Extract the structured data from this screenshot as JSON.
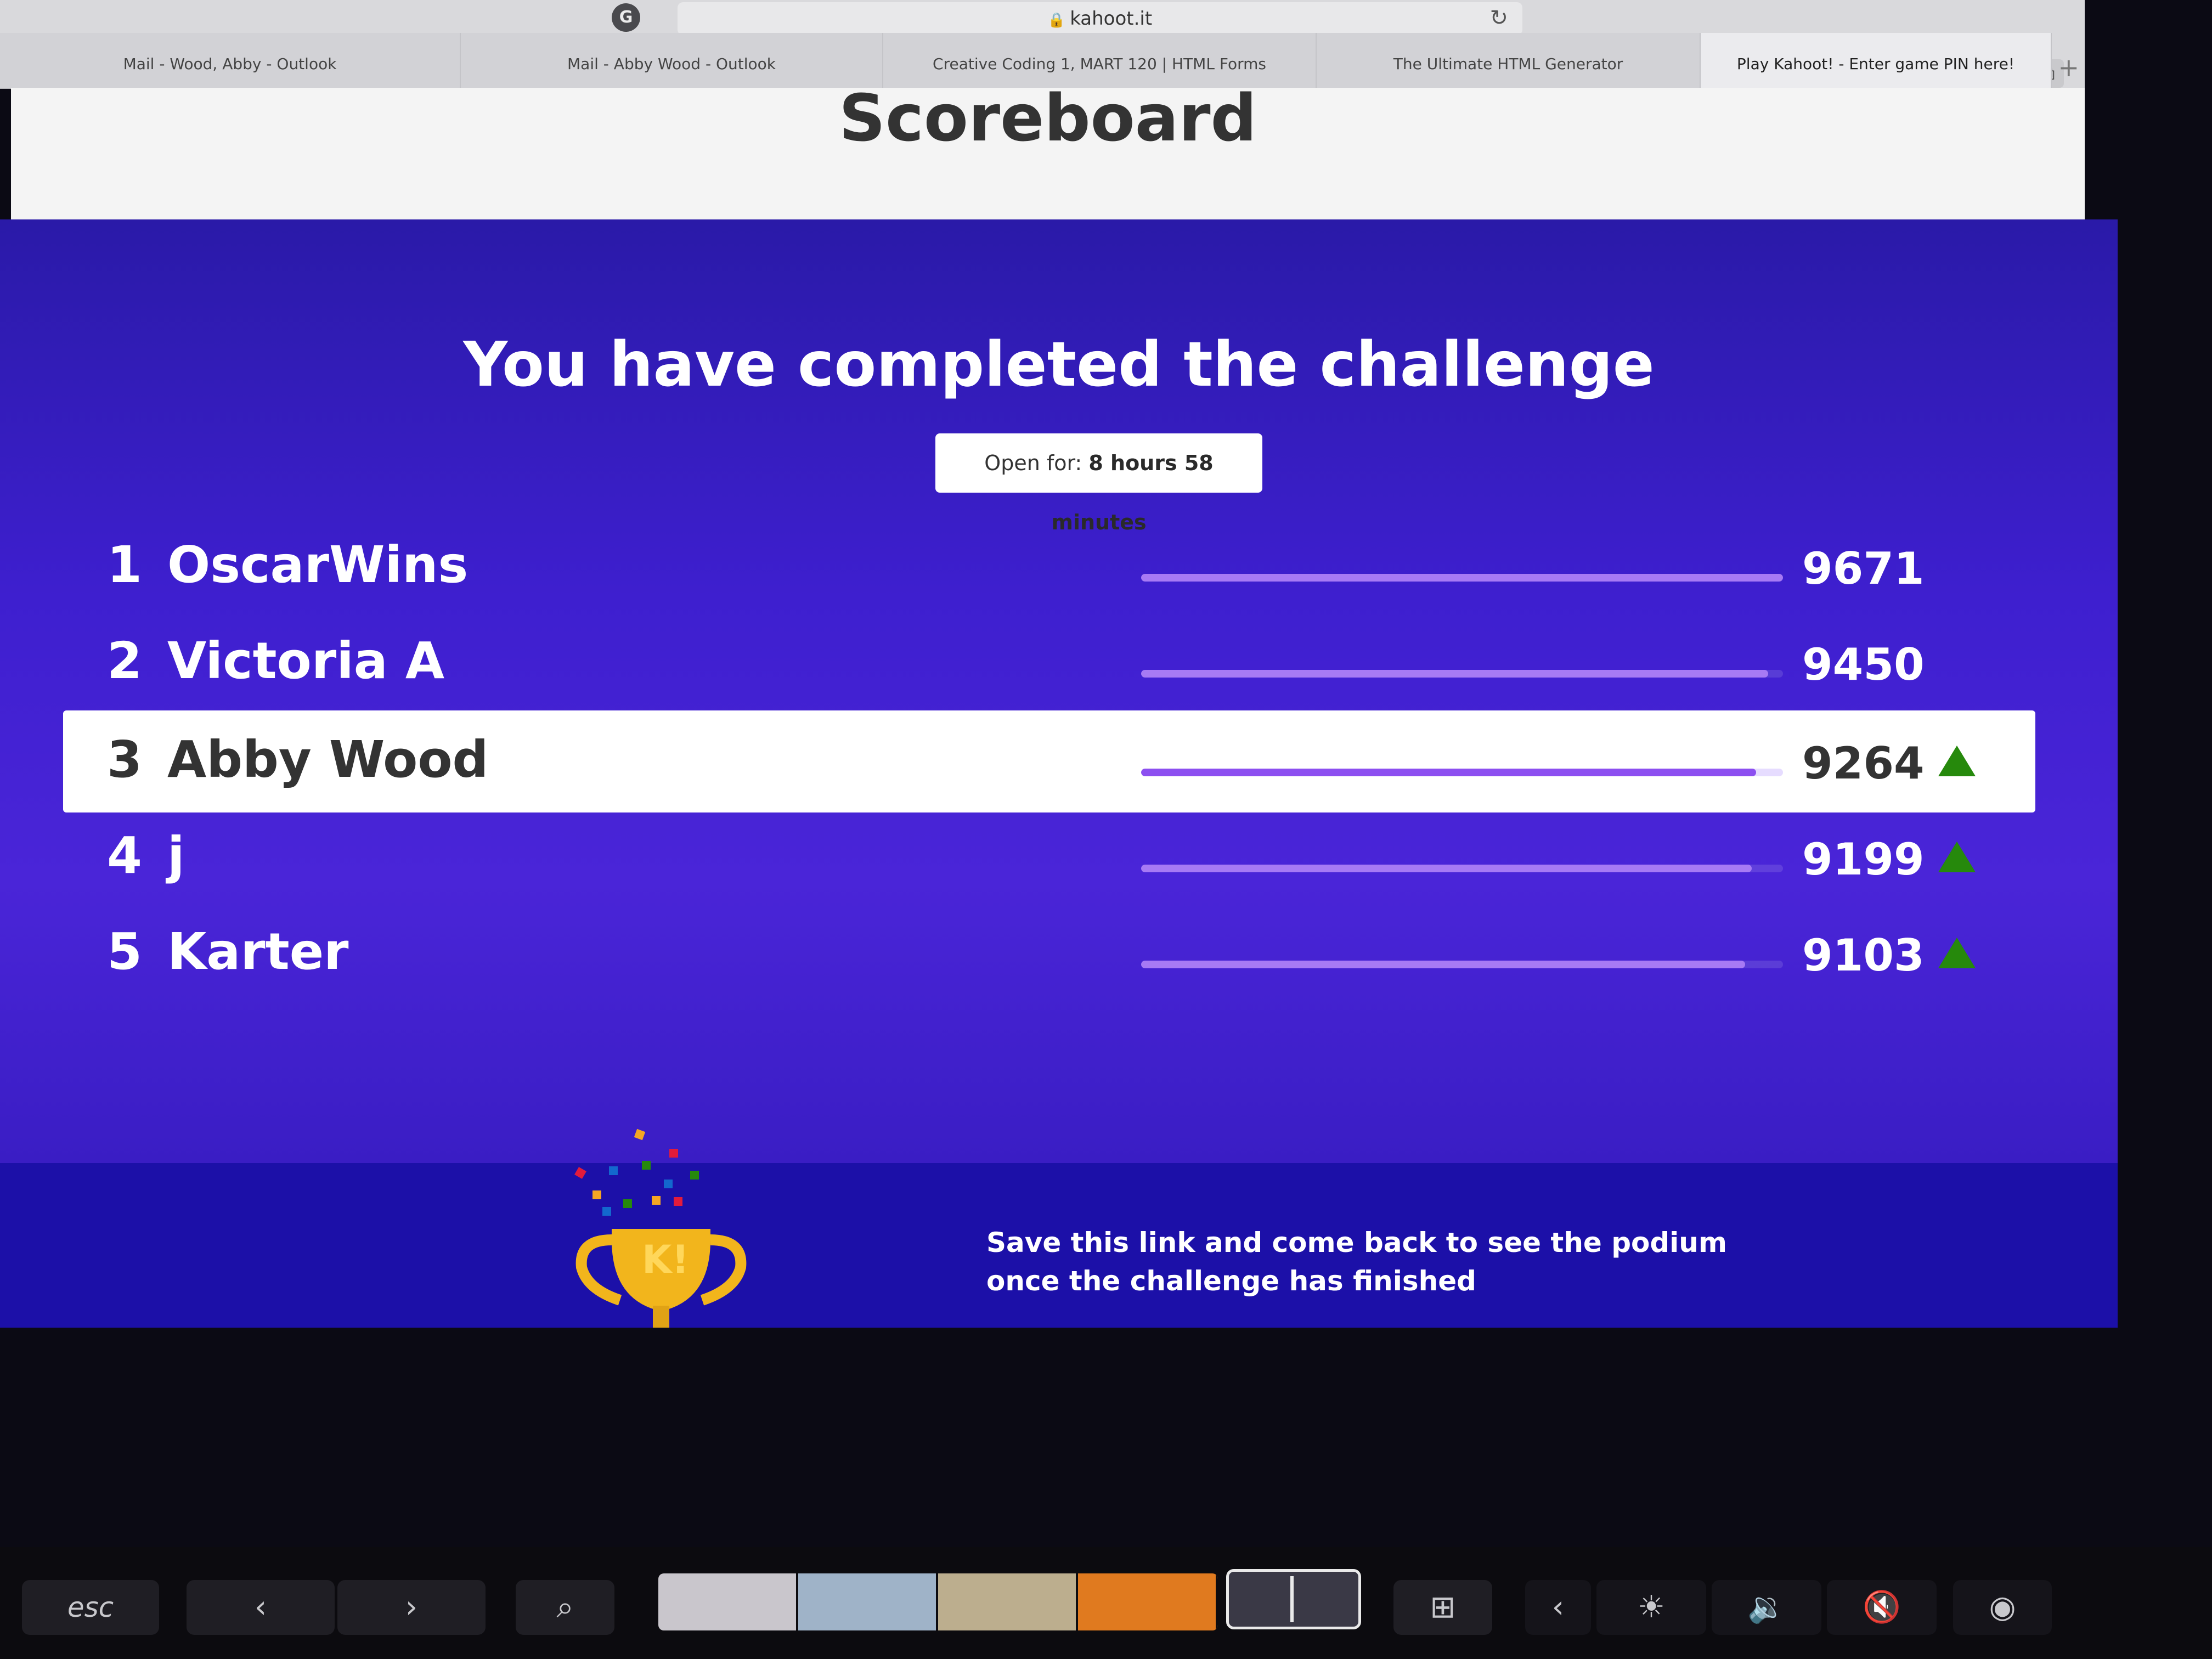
{
  "browser": {
    "url": "kahoot.it",
    "tabs": [
      {
        "label": "Mail - Wood, Abby - Outlook"
      },
      {
        "label": "Mail - Abby Wood - Outlook"
      },
      {
        "label": "Creative Coding 1, MART 120 | HTML Forms"
      },
      {
        "label": "The Ultimate HTML Generator"
      },
      {
        "label": "Play Kahoot! - Enter game PIN here!",
        "active": true
      }
    ],
    "new_tab": "+"
  },
  "header": {
    "title": "Scoreboard"
  },
  "challenge": {
    "headline": "You have completed the challenge",
    "open_for_label": "Open for:",
    "open_for_value": "8 hours 58 minutes"
  },
  "leaderboard": {
    "rows": [
      {
        "rank": "1",
        "name": "OscarWins",
        "score": "9671",
        "bar_fraction": 1.0,
        "arrow": false,
        "highlight": false
      },
      {
        "rank": "2",
        "name": "Victoria A",
        "score": "9450",
        "bar_fraction": 0.977,
        "arrow": false,
        "highlight": false
      },
      {
        "rank": "3",
        "name": "Abby Wood",
        "score": "9264",
        "bar_fraction": 0.958,
        "arrow": true,
        "highlight": true
      },
      {
        "rank": "4",
        "name": "j",
        "score": "9199",
        "bar_fraction": 0.951,
        "arrow": true,
        "highlight": false
      },
      {
        "rank": "5",
        "name": "Karter",
        "score": "9103",
        "bar_fraction": 0.941,
        "arrow": true,
        "highlight": false
      }
    ]
  },
  "footer": {
    "message_line1": "Save this link and come back to see the podium",
    "message_line2": "once the challenge has finished"
  },
  "touch_bar": {
    "esc_label": "esc"
  },
  "colors": {
    "purple_bg": "#3e1fcf",
    "bar_fill": "#a77af4",
    "arrow_green": "#26890c",
    "footer_band": "#1c10a8"
  }
}
